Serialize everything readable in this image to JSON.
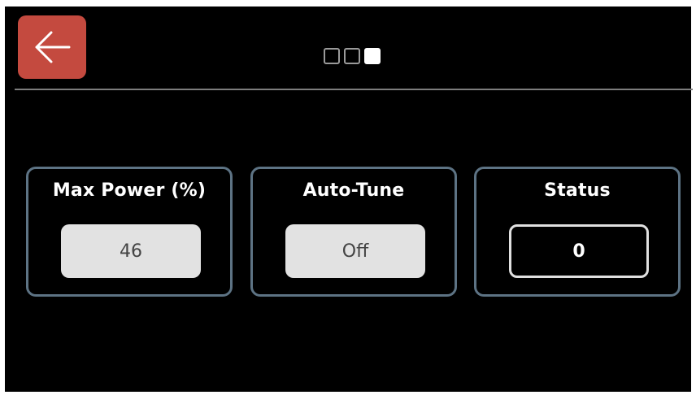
{
  "header": {
    "back_icon": "arrow-left-icon",
    "pager": {
      "count": 3,
      "active_index": 2
    }
  },
  "cards": {
    "max_power": {
      "title": "Max Power (%)",
      "value": "46"
    },
    "auto_tune": {
      "title": "Auto-Tune",
      "value": "Off"
    },
    "status": {
      "title": "Status",
      "value": "0"
    }
  },
  "colors": {
    "background": "#000000",
    "back_button": "#c44a3f",
    "card_border": "#5d7384",
    "field_fill": "#e2e2e2"
  }
}
